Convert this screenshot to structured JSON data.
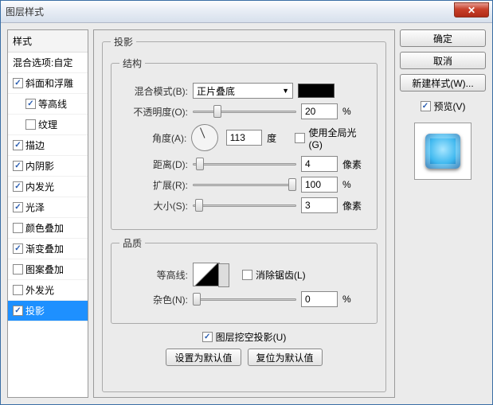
{
  "window": {
    "title": "图层样式"
  },
  "left": {
    "header": "样式",
    "blend_options": "混合选项:自定",
    "items": [
      {
        "label": "斜面和浮雕",
        "checked": true,
        "sub": false
      },
      {
        "label": "等高线",
        "checked": true,
        "sub": true
      },
      {
        "label": "纹理",
        "checked": false,
        "sub": true
      },
      {
        "label": "描边",
        "checked": true,
        "sub": false
      },
      {
        "label": "内阴影",
        "checked": true,
        "sub": false
      },
      {
        "label": "内发光",
        "checked": true,
        "sub": false
      },
      {
        "label": "光泽",
        "checked": true,
        "sub": false
      },
      {
        "label": "颜色叠加",
        "checked": false,
        "sub": false
      },
      {
        "label": "渐变叠加",
        "checked": true,
        "sub": false
      },
      {
        "label": "图案叠加",
        "checked": false,
        "sub": false
      },
      {
        "label": "外发光",
        "checked": false,
        "sub": false
      },
      {
        "label": "投影",
        "checked": true,
        "sub": false,
        "selected": true
      }
    ]
  },
  "middle": {
    "group_title": "投影",
    "structure_title": "结构",
    "quality_title": "品质",
    "blend_mode_label": "混合模式(B):",
    "blend_mode_value": "正片叠底",
    "opacity_label": "不透明度(O):",
    "opacity_value": "20",
    "opacity_unit": "%",
    "angle_label": "角度(A):",
    "angle_value": "113",
    "angle_unit": "度",
    "global_light_label": "使用全局光(G)",
    "distance_label": "距离(D):",
    "distance_value": "4",
    "distance_unit": "像素",
    "spread_label": "扩展(R):",
    "spread_value": "100",
    "spread_unit": "%",
    "size_label": "大小(S):",
    "size_value": "3",
    "size_unit": "像素",
    "contour_label": "等高线:",
    "antialias_label": "消除锯齿(L)",
    "noise_label": "杂色(N):",
    "noise_value": "0",
    "noise_unit": "%",
    "knockout_label": "图层挖空投影(U)",
    "knockout_checked": true,
    "set_default": "设置为默认值",
    "reset_default": "复位为默认值"
  },
  "right": {
    "ok": "确定",
    "cancel": "取消",
    "new_style": "新建样式(W)...",
    "preview_label": "预览(V)",
    "preview_checked": true
  }
}
